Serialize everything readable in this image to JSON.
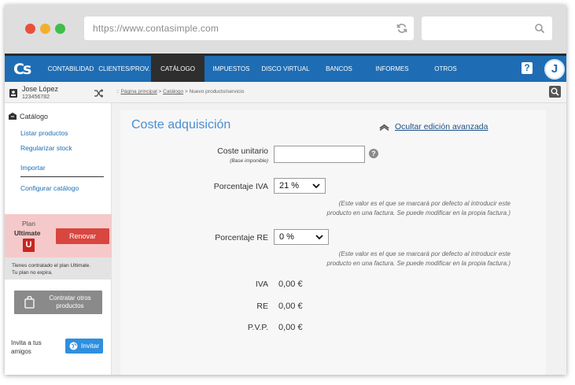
{
  "browser": {
    "url": "https://www.contasimple.com"
  },
  "app": {
    "logo": "Cs",
    "nav": [
      {
        "label": "CONTABILIDAD"
      },
      {
        "label": "CLIENTES/PROV."
      },
      {
        "label": "CATÁLOGO"
      },
      {
        "label": "IMPUESTOS"
      },
      {
        "label": "DISCO VIRTUAL"
      },
      {
        "label": "BANCOS"
      },
      {
        "label": "INFORMES"
      },
      {
        "label": "OTROS"
      }
    ],
    "help": "?",
    "avatar_initial": "J"
  },
  "user": {
    "name": "Jose López",
    "id": "123456782"
  },
  "sidebar": {
    "section_title": "Catálogo",
    "items": [
      {
        "label": "Listar productos"
      },
      {
        "label": "Regularizar stock"
      },
      {
        "label": "Importar"
      },
      {
        "label": "Configurar catálogo"
      }
    ],
    "plan": {
      "word": "Plan",
      "name": "Ultimate",
      "badge": "U",
      "renew_label": "Renovar",
      "note_line1": "Tienes contratado el plan Ultimate.",
      "note_line2": "Tu plan no expira."
    },
    "contract_label_1": "Contratar otros",
    "contract_label_2": "productos",
    "invite_text_1": "Invita a tus",
    "invite_text_2": "amigos",
    "invite_button": "Invitar"
  },
  "breadcrumb": {
    "prefix": "::",
    "home": "Página principal",
    "sep1": ">",
    "catalog": "Catálogo",
    "sep2": ">",
    "current": "Nuevo producto/servicio"
  },
  "form": {
    "section_title": "Coste adquisición",
    "advanced_link": "Ocultar edición avanzada",
    "unit_cost_label": "Coste unitario",
    "unit_cost_sublabel": "(Base imponible)",
    "unit_cost_value": "",
    "vat_label": "Porcentaje IVA",
    "vat_value": "21 %",
    "vat_hint_1": "(Este valor es el que se marcará por defecto al introducir este",
    "vat_hint_2": "producto en una factura. Se puede modificar en la propia factura.)",
    "re_label": "Porcentaje RE",
    "re_value": "0 %",
    "re_hint_1": "(Este valor es el que se marcará por defecto al introducir este",
    "re_hint_2": "producto en una factura. Se puede modificar en la propia factura.)",
    "totals": [
      {
        "label": "IVA",
        "value": "0,00 €"
      },
      {
        "label": "RE",
        "value": "0,00 €"
      },
      {
        "label": "P.V.P.",
        "value": "0,00 €"
      }
    ]
  },
  "colors": {
    "nav_bg": "#1e6db4",
    "accent_title": "#4a8ed0",
    "renew_button": "#d9453f",
    "plan_box": "#f5c9c9"
  }
}
